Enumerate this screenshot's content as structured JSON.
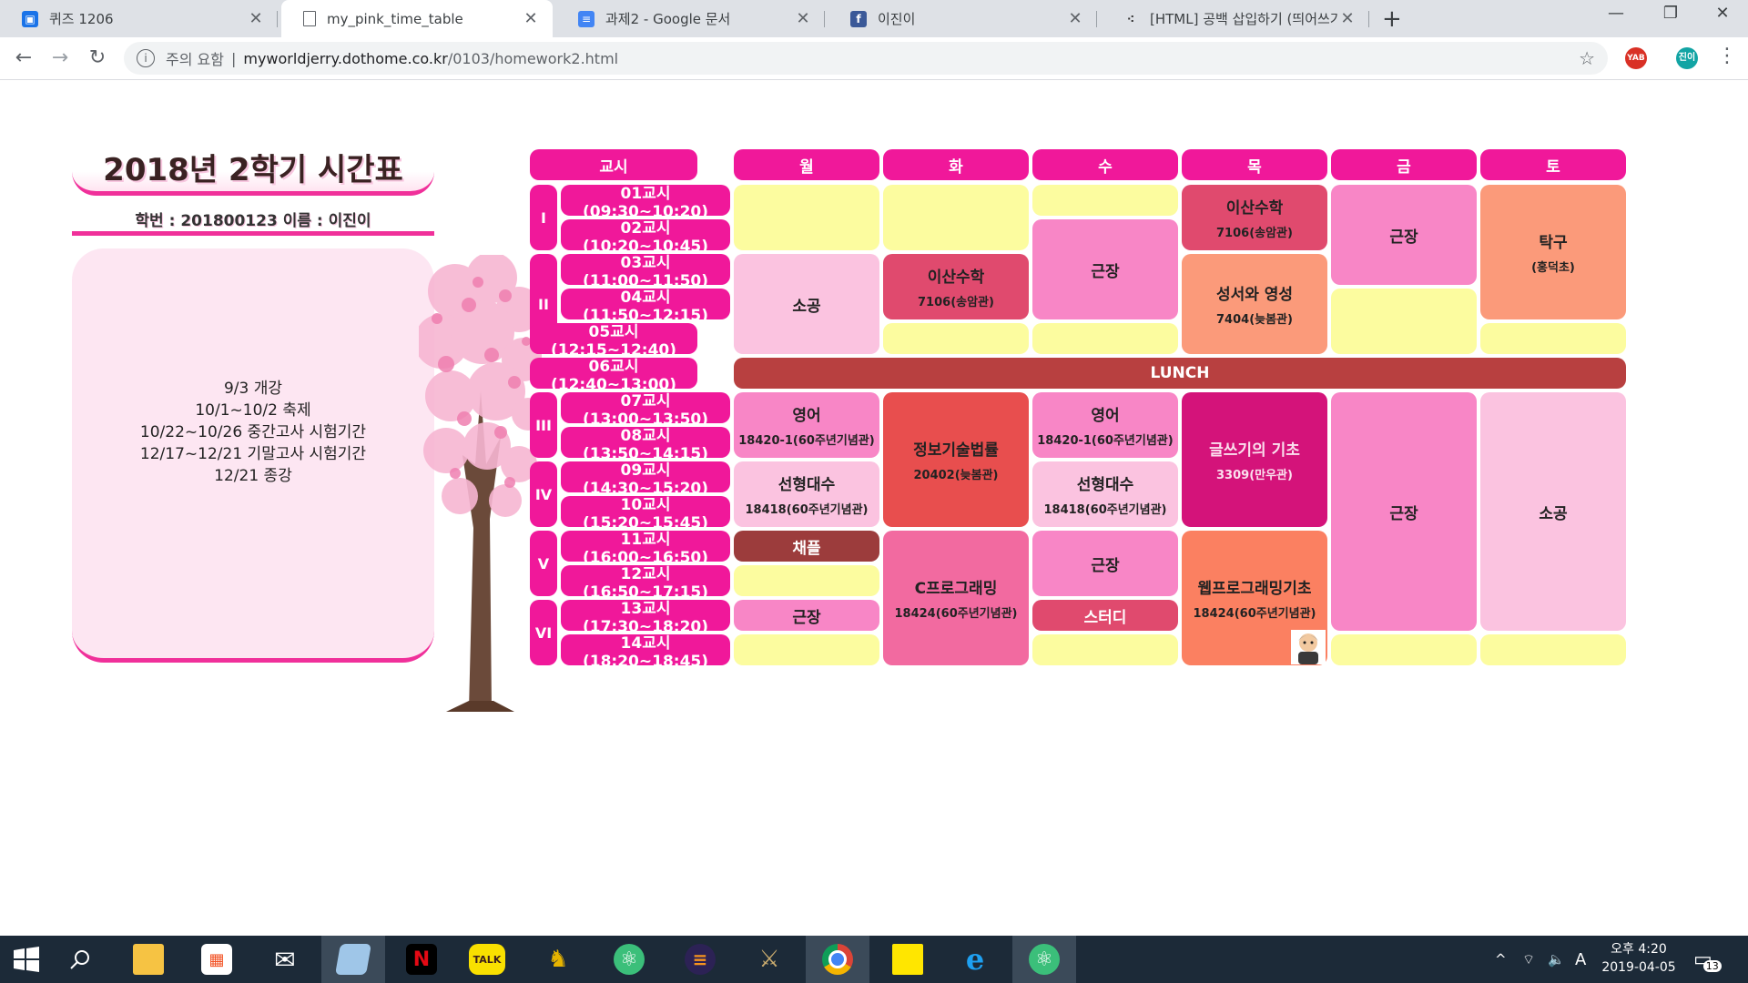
{
  "browser": {
    "tabs": [
      {
        "title": "퀴즈 1206",
        "icon": "classroom-icon"
      },
      {
        "title": "my_pink_time_table",
        "icon": "page-icon",
        "active": true
      },
      {
        "title": "과제2 - Google 문서",
        "icon": "docs-icon"
      },
      {
        "title": "이진이",
        "icon": "facebook-icon"
      },
      {
        "title": "[HTML] 공백 삽입하기 (띄어쓰기",
        "icon": "tistory-icon"
      }
    ],
    "address": {
      "security_warning": "주의 요함",
      "domain": "myworldjerry.dothome.co.kr",
      "path": "/0103/homework2.html"
    },
    "extensions": {
      "yab_label": "YAB",
      "profile_label": "진이"
    }
  },
  "page": {
    "title": "2018년 2학기 시간표",
    "student_info": "학번 : 201800123 이름 : 이진이",
    "events": [
      "9/3 개강",
      "10/1~10/2 축제",
      "10/22~10/26 중간고사 시험기간",
      "12/17~12/21 기말고사 시험기간",
      "12/21 종강"
    ]
  },
  "timetable": {
    "headers": [
      "교시",
      "월",
      "화",
      "수",
      "목",
      "금",
      "토"
    ],
    "blocks": [
      "I",
      "II",
      "III",
      "IV",
      "V",
      "VI"
    ],
    "periods": [
      "01교시(09:30~10:20)",
      "02교시(10:20~10:45)",
      "03교시(11:00~11:50)",
      "04교시(11:50~12:15)",
      "05교시(12:15~12:40)",
      "06교시(12:40~13:00)",
      "07교시(13:00~13:50)",
      "08교시(13:50~14:15)",
      "09교시(14:30~15:20)",
      "10교시(15:20~15:45)",
      "11교시(16:00~16:50)",
      "12교시(16:50~17:15)",
      "13교시(17:30~18:20)",
      "14교시(18:20~18:45)"
    ],
    "lunch": "LUNCH",
    "classes": {
      "mon_p3": {
        "name": "소공",
        "room": ""
      },
      "mon_p7": {
        "name": "영어",
        "room": "18420-1(60주년기념관)"
      },
      "mon_p9": {
        "name": "선형대수",
        "room": "18418(60주년기념관)"
      },
      "mon_p11": {
        "name": "채플",
        "room": ""
      },
      "mon_p13": {
        "name": "근장",
        "room": ""
      },
      "tue_p3": {
        "name": "이산수학",
        "room": "7106(송암관)"
      },
      "tue_p7": {
        "name": "정보기술법률",
        "room": "20402(늦봄관)"
      },
      "tue_p11": {
        "name": "C프로그래밍",
        "room": "18424(60주년기념관)"
      },
      "wed_p2": {
        "name": "근장",
        "room": ""
      },
      "wed_p7": {
        "name": "영어",
        "room": "18420-1(60주년기념관)"
      },
      "wed_p9": {
        "name": "선형대수",
        "room": "18418(60주년기념관)"
      },
      "wed_p11": {
        "name": "근장",
        "room": ""
      },
      "wed_p13": {
        "name": "스터디",
        "room": ""
      },
      "thu_p1": {
        "name": "이산수학",
        "room": "7106(송암관)"
      },
      "thu_p3": {
        "name": "성서와 영성",
        "room": "7404(늦봄관)"
      },
      "thu_p7": {
        "name": "글쓰기의 기초",
        "room": "3309(만우관)"
      },
      "thu_p11": {
        "name": "웹프로그래밍기초",
        "room": "18424(60주년기념관)"
      },
      "fri_p1": {
        "name": "근장",
        "room": ""
      },
      "fri_p7": {
        "name": "근장",
        "room": ""
      },
      "sat_p1": {
        "name": "탁구",
        "room": "(홍덕초)"
      },
      "sat_p7": {
        "name": "소공",
        "room": ""
      }
    },
    "colors": {
      "pink_header": "#f0189a",
      "light_yellow": "#fcfc9f",
      "light_pink": "#fbc3e0",
      "mid_pink": "#f886c6",
      "rose": "#e04a6e",
      "salmon": "#fb9a7a",
      "coral": "#fb8061",
      "tomato": "#e84e4e",
      "magenta": "#d4137a",
      "maroon": "#9c3c3c",
      "lunch": "#b84040"
    }
  },
  "taskbar": {
    "apps": [
      "file-explorer-icon",
      "store-icon",
      "mail-icon",
      "notepad-icon",
      "netflix-icon",
      "kakaotalk-icon",
      "game-icon",
      "atom-icon",
      "eclipse-icon",
      "league-icon",
      "chrome-icon",
      "sticky-notes-icon",
      "ie-icon",
      "atom-icon"
    ],
    "kakao_label": "TALK",
    "netflix_label": "N",
    "ime": "A",
    "time": "오후 4:20",
    "date": "2019-04-05",
    "notifications": "13"
  }
}
